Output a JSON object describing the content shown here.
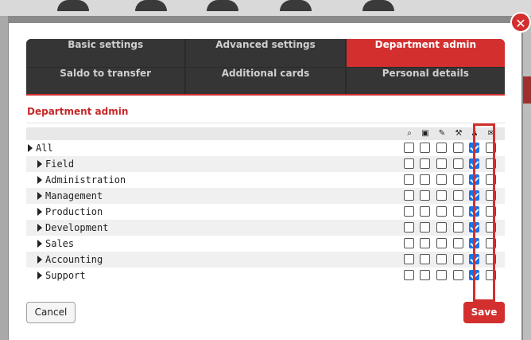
{
  "tabs": {
    "row1": [
      {
        "label": "Basic settings",
        "active": false
      },
      {
        "label": "Advanced settings",
        "active": false
      },
      {
        "label": "Department admin",
        "active": true
      }
    ],
    "row2": [
      {
        "label": "Saldo to transfer",
        "active": false
      },
      {
        "label": "Additional cards",
        "active": false
      },
      {
        "label": "Personal details",
        "active": false
      }
    ]
  },
  "section": {
    "title": "Department admin"
  },
  "columns": [
    {
      "icon": "search-icon",
      "glyph": "⌕"
    },
    {
      "icon": "image-icon",
      "glyph": "▣"
    },
    {
      "icon": "pencil-icon",
      "glyph": "✎"
    },
    {
      "icon": "wrench-icon",
      "glyph": "⚒"
    },
    {
      "icon": "user-icon",
      "glyph": "♟"
    },
    {
      "icon": "comment-icon",
      "glyph": "✉"
    }
  ],
  "rows": [
    {
      "label": "All",
      "indent": 0,
      "checks": [
        false,
        false,
        false,
        false,
        true,
        false
      ]
    },
    {
      "label": "Field",
      "indent": 1,
      "checks": [
        false,
        false,
        false,
        false,
        true,
        false
      ]
    },
    {
      "label": "Administration",
      "indent": 1,
      "checks": [
        false,
        false,
        false,
        false,
        true,
        false
      ]
    },
    {
      "label": "Management",
      "indent": 1,
      "checks": [
        false,
        false,
        false,
        false,
        true,
        false
      ]
    },
    {
      "label": "Production",
      "indent": 1,
      "checks": [
        false,
        false,
        false,
        false,
        true,
        false
      ]
    },
    {
      "label": "Development",
      "indent": 1,
      "checks": [
        false,
        false,
        false,
        false,
        true,
        false
      ]
    },
    {
      "label": "Sales",
      "indent": 1,
      "checks": [
        false,
        false,
        false,
        false,
        true,
        false
      ]
    },
    {
      "label": "Accounting",
      "indent": 1,
      "checks": [
        false,
        false,
        false,
        false,
        true,
        false
      ]
    },
    {
      "label": "Support",
      "indent": 1,
      "checks": [
        false,
        false,
        false,
        false,
        true,
        false
      ]
    }
  ],
  "buttons": {
    "cancel": "Cancel",
    "save": "Save"
  },
  "close": {
    "glyph": "✕"
  },
  "colors": {
    "accent": "#d32f2f",
    "tab_bg": "#353535",
    "checkbox_on": "#1a73e8"
  }
}
